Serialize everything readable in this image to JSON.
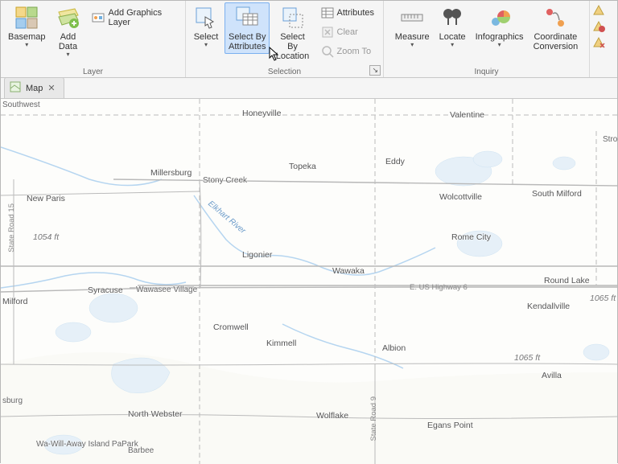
{
  "ribbon": {
    "groups": {
      "layer": {
        "label": "Layer",
        "basemap": "Basemap",
        "add_data": "Add\nData",
        "add_graphics": "Add Graphics Layer"
      },
      "selection": {
        "label": "Selection",
        "select": "Select",
        "select_by_attributes": "Select By\nAttributes",
        "select_by_location": "Select By\nLocation",
        "attributes": "Attributes",
        "clear": "Clear",
        "zoom_to": "Zoom To"
      },
      "inquiry": {
        "label": "Inquiry",
        "measure": "Measure",
        "locate": "Locate",
        "infographics": "Infographics",
        "coord": "Coordinate\nConversion"
      }
    }
  },
  "tab": {
    "label": "Map"
  },
  "map_labels": {
    "southwest": "Southwest",
    "honeyville": "Honeyville",
    "valentine": "Valentine",
    "str": "Stro",
    "millersburg": "Millersburg",
    "stonycreek": "Stony Creek",
    "topeka": "Topeka",
    "eddy": "Eddy",
    "newparis": "New Paris",
    "wolcottville": "Wolcottville",
    "southmilford": "South Milford",
    "ligonier": "Ligonier",
    "romecity": "Rome City",
    "wawaka": "Wawaka",
    "roundlake": "Round Lake",
    "syracuse": "Syracuse",
    "wawaseevillage": "Wawasee\nVillage",
    "milford": "Milford",
    "ehighway": "E. US Highway 6",
    "kendallville": "Kendallville",
    "cromwell": "Cromwell",
    "kimmell": "Kimmell",
    "albion": "Albion",
    "sburg": "sburg",
    "northwebster": "North Webster",
    "wolflake": "Wolflake",
    "eganspoint": "Egans Point",
    "avilla": "Avilla",
    "wawillaway": "Wa-Will-Away\nIsland PaPark",
    "barbee": "Barbee",
    "elev1054": "1054 ft",
    "elev1065a": "1065 ft",
    "elev1065b": "1065 ft",
    "elkhart": "Elkhart River",
    "stateroad15": "State Road 15",
    "stateroad9": "State Road 9"
  }
}
